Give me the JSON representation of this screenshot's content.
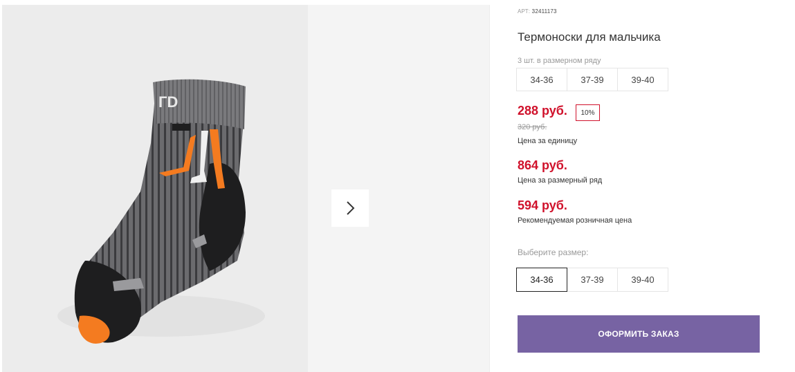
{
  "gallery": {
    "next_icon": "chevron-right-icon"
  },
  "product": {
    "art_label": "АРТ:",
    "art_number": "32411173",
    "title": "Термоноски для мальчика",
    "pack_label": "3 шт. в размерном ряду",
    "pack_sizes": [
      "34-36",
      "37-39",
      "39-40"
    ],
    "price": "288 руб.",
    "discount": "10%",
    "old_price": "320 руб.",
    "unit_price_note": "Цена за единицу",
    "pack_price": "864 руб.",
    "pack_price_note": "Цена за размерный ряд",
    "retail_price": "594 руб.",
    "retail_price_note": "Рекомендуемая розничная цена",
    "choose_size_label": "Выберите размер:",
    "choose_sizes": [
      "34-36",
      "37-39",
      "39-40"
    ],
    "selected_size": "34-36",
    "order_button": "ОФОРМИТЬ ЗАКАЗ"
  },
  "colors": {
    "price_red": "#d0112b",
    "button_purple": "#7763a3",
    "sock_orange": "#f47b20"
  }
}
